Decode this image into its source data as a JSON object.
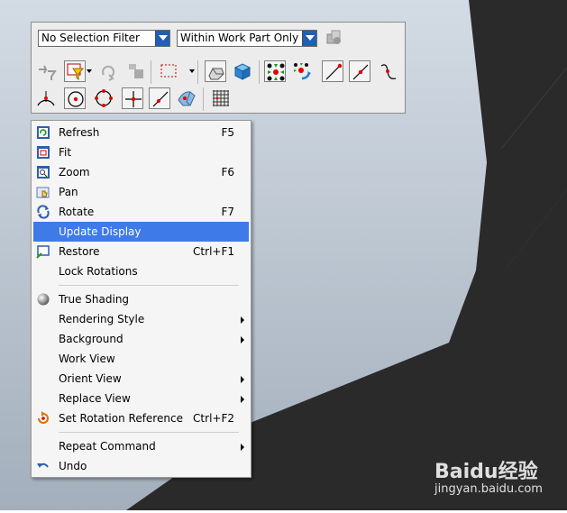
{
  "toolbar": {
    "selection_filter": "No Selection Filter",
    "scope_filter": "Within Work Part Only",
    "row1_icons": [
      "select-filter-disabled-icon",
      "type-filter-icon",
      "deselect-all-icon",
      "general-selection-icon",
      "rectangle-selection-icon",
      "body-select-icon",
      "face-select-icon",
      "feature-select-icon",
      "component-select-icon",
      "line-endpoint-icon",
      "line-midpoint-icon",
      "curve-icon"
    ],
    "row2_icons": [
      "arc-center-icon",
      "circle-center-icon",
      "quadrant-point-icon",
      "intersection-point-icon",
      "point-on-curve-icon",
      "point-on-surface-icon",
      "grid-icon"
    ]
  },
  "context_menu": {
    "items": [
      {
        "label": "Refresh",
        "shortcut": "F5",
        "icon": "refresh-icon"
      },
      {
        "label": "Fit",
        "shortcut": "",
        "icon": "fit-icon"
      },
      {
        "label": "Zoom",
        "shortcut": "F6",
        "icon": "zoom-icon"
      },
      {
        "label": "Pan",
        "shortcut": "",
        "icon": "pan-icon"
      },
      {
        "label": "Rotate",
        "shortcut": "F7",
        "icon": "rotate-icon"
      },
      {
        "label": "Update Display",
        "shortcut": "",
        "icon": ""
      },
      {
        "label": "Restore",
        "shortcut": "Ctrl+F1",
        "icon": "restore-icon"
      },
      {
        "label": "Lock Rotations",
        "shortcut": "",
        "icon": ""
      },
      {
        "label": "True Shading",
        "shortcut": "",
        "icon": "true-shading-icon"
      },
      {
        "label": "Rendering Style",
        "shortcut": "",
        "icon": "",
        "submenu": true
      },
      {
        "label": "Background",
        "shortcut": "",
        "icon": "",
        "submenu": true
      },
      {
        "label": "Work View",
        "shortcut": "",
        "icon": ""
      },
      {
        "label": "Orient View",
        "shortcut": "",
        "icon": "",
        "submenu": true
      },
      {
        "label": "Replace View",
        "shortcut": "",
        "icon": "",
        "submenu": true
      },
      {
        "label": "Set Rotation Reference",
        "shortcut": "Ctrl+F2",
        "icon": "rotation-reference-icon"
      },
      {
        "label": "Repeat Command",
        "shortcut": "",
        "icon": "",
        "submenu": true
      },
      {
        "label": "Undo",
        "shortcut": "",
        "icon": "undo-icon"
      }
    ],
    "highlighted": "Update Display"
  },
  "watermark": {
    "brand": "Baidu经验",
    "site": "jingyan.baidu.com"
  },
  "colors": {
    "highlight": "#3e7ae8",
    "viewport_top": "#d0d9e3",
    "viewport_bottom": "#a6b2bf",
    "dark_model": "#2b2b2b"
  }
}
